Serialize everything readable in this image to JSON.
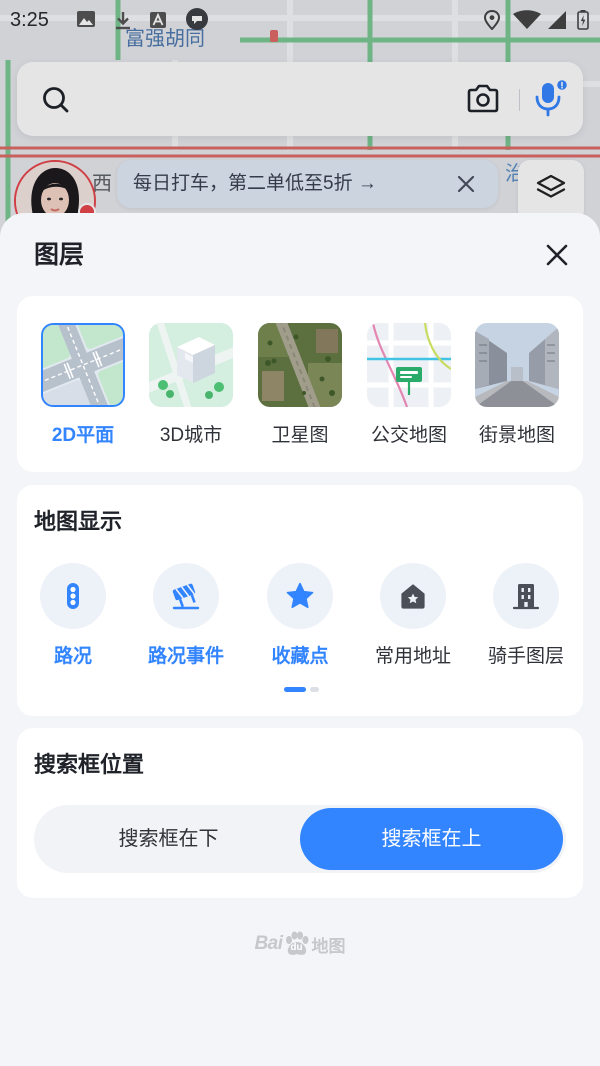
{
  "status_bar": {
    "time": "3:25",
    "left_icons": [
      "image-icon",
      "download-icon",
      "text-a-icon",
      "chat-bubble-icon"
    ],
    "right_icons": [
      "location-icon",
      "wifi-icon",
      "signal-icon",
      "battery-icon"
    ]
  },
  "map": {
    "labels": [
      "富强胡同",
      "西",
      "治"
    ]
  },
  "search_bar": {
    "icons": [
      "search-icon",
      "camera-icon",
      "microphone-icon"
    ]
  },
  "promo_banner": {
    "text": "每日打车，第二单低至5折 →",
    "close_icon": "close-icon"
  },
  "layers_button": {
    "icon": "layers-icon"
  },
  "layers_sheet": {
    "title": "图层",
    "close_icon": "close-icon",
    "map_types": [
      {
        "label": "2D平面",
        "selected": true
      },
      {
        "label": "3D城市",
        "selected": false
      },
      {
        "label": "卫星图",
        "selected": false
      },
      {
        "label": "公交地图",
        "selected": false
      },
      {
        "label": "街景地图",
        "selected": false
      }
    ],
    "map_display": {
      "heading": "地图显示",
      "items": [
        {
          "label": "路况",
          "icon": "traffic-light-icon",
          "active": true
        },
        {
          "label": "路况事件",
          "icon": "road-event-icon",
          "active": true
        },
        {
          "label": "收藏点",
          "icon": "star-icon",
          "active": true
        },
        {
          "label": "常用地址",
          "icon": "home-icon",
          "active": false
        },
        {
          "label": "骑手图层",
          "icon": "building-icon",
          "active": false
        }
      ],
      "current_page": 1,
      "page_count": 2
    },
    "search_position": {
      "heading": "搜索框位置",
      "options": [
        {
          "label": "搜索框在下",
          "selected": false
        },
        {
          "label": "搜索框在上",
          "selected": true
        }
      ]
    }
  },
  "brand_logo": {
    "part1": "Bai",
    "part2": "du",
    "suffix": "地图"
  },
  "colors": {
    "accent": "#3385ff",
    "sheet_bg": "#f4f5f9",
    "card_bg": "#ffffff",
    "text": "#1f2329",
    "inactive_icon": "#4a4f58",
    "avatar_ring": "#e8454a"
  }
}
